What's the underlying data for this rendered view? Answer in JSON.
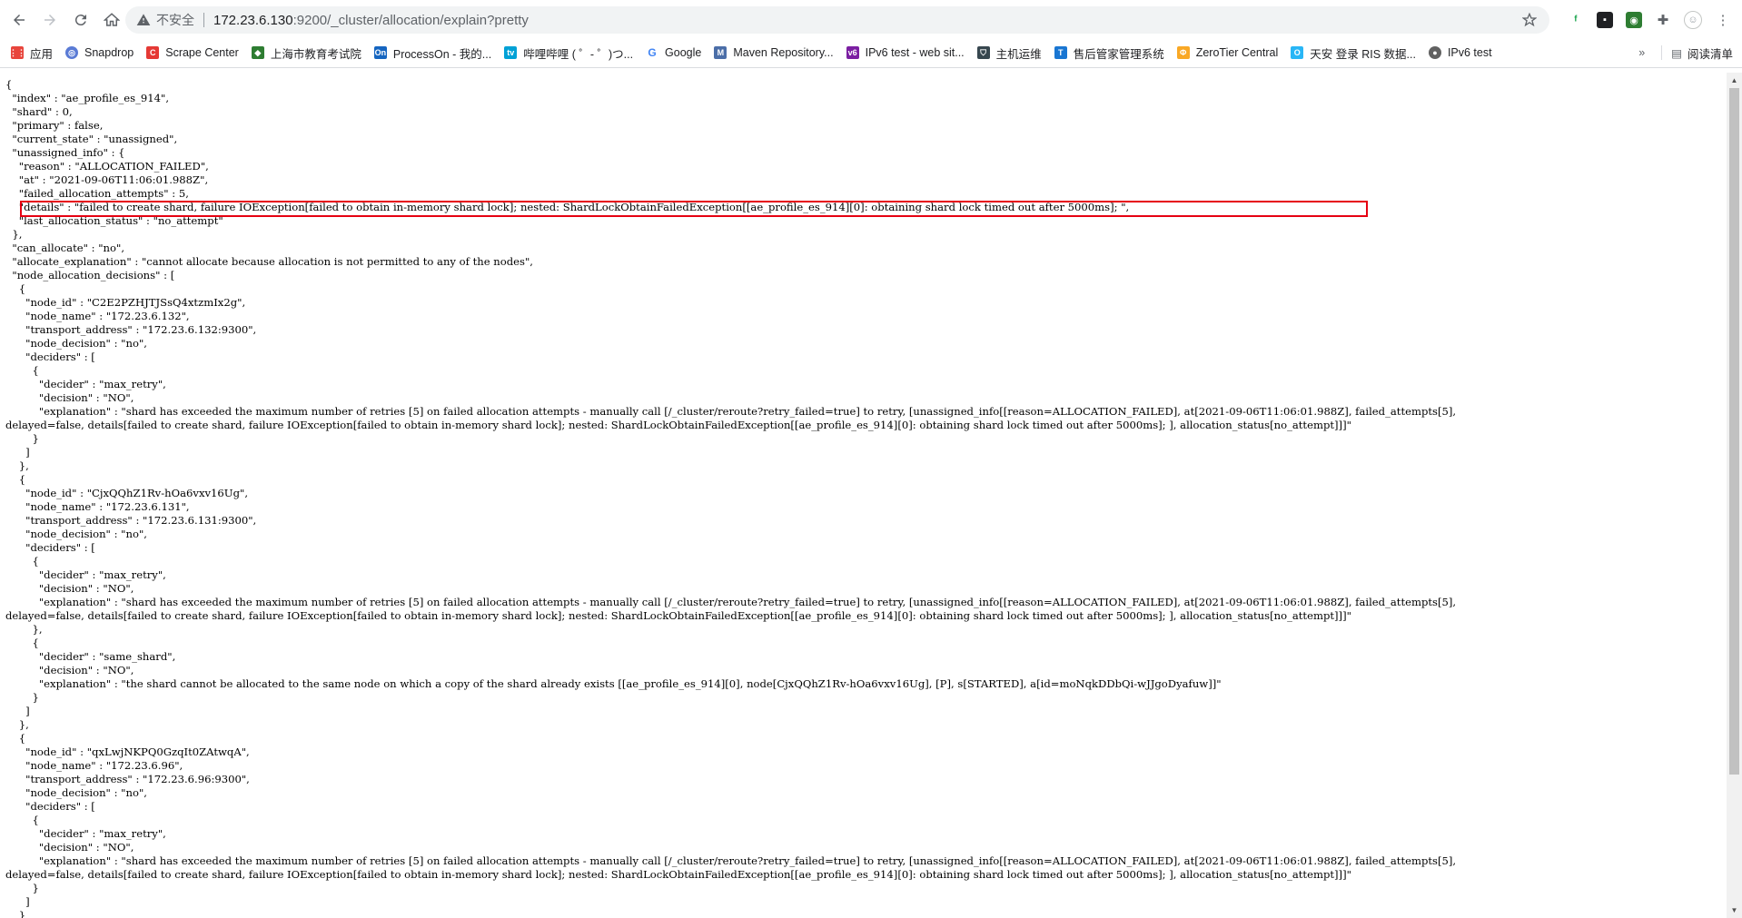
{
  "browser": {
    "insecure_label": "不安全",
    "url_host": "172.23.6.130",
    "url_path": ":9200/_cluster/allocation/explain?pretty",
    "reading_list_label": "阅读清单"
  },
  "bookmarks": [
    {
      "label": "应用",
      "icon": "apps-grid-icon",
      "color": "#e8453c"
    },
    {
      "label": "Snapdrop",
      "icon": "snapdrop-icon",
      "color": "#5a7bd5"
    },
    {
      "label": "Scrape Center",
      "icon": "scrape-center-icon",
      "color": "#e53935"
    },
    {
      "label": "上海市教育考试院",
      "icon": "school-icon",
      "color": "#2e7d32"
    },
    {
      "label": "ProcessOn - 我的...",
      "icon": "processon-icon",
      "color": "#1565c0"
    },
    {
      "label": "哔哩哔哩 ( ゜- ゜)つ...",
      "icon": "bilibili-icon",
      "color": "#00a1d6"
    },
    {
      "label": "Google",
      "icon": "google-icon",
      "color": "#4285f4"
    },
    {
      "label": "Maven Repository...",
      "icon": "maven-icon",
      "color": "#4b6ea8"
    },
    {
      "label": "IPv6 test - web sit...",
      "icon": "ipv6-icon",
      "color": "#7b1fa2"
    },
    {
      "label": "主机运维",
      "icon": "shield-icon",
      "color": "#37474f"
    },
    {
      "label": "售后管家管理系统",
      "icon": "t-icon",
      "color": "#1976d2"
    },
    {
      "label": "ZeroTier Central",
      "icon": "zerotier-icon",
      "color": "#f9a825"
    },
    {
      "label": "天安 登录 RIS 数据...",
      "icon": "tianan-icon",
      "color": "#29b6f6"
    },
    {
      "label": "IPv6 test",
      "icon": "globe-icon",
      "color": "#616161"
    }
  ],
  "json_lines": [
    "{",
    "  \"index\" : \"ae_profile_es_914\",",
    "  \"shard\" : 0,",
    "  \"primary\" : false,",
    "  \"current_state\" : \"unassigned\",",
    "  \"unassigned_info\" : {",
    "    \"reason\" : \"ALLOCATION_FAILED\",",
    "    \"at\" : \"2021-09-06T11:06:01.988Z\",",
    "    \"failed_allocation_attempts\" : 5,",
    "    \"details\" : \"failed to create shard, failure IOException[failed to obtain in-memory shard lock]; nested: ShardLockObtainFailedException[[ae_profile_es_914][0]: obtaining shard lock timed out after 5000ms]; \",",
    "    \"last_allocation_status\" : \"no_attempt\"",
    "  },",
    "  \"can_allocate\" : \"no\",",
    "  \"allocate_explanation\" : \"cannot allocate because allocation is not permitted to any of the nodes\",",
    "  \"node_allocation_decisions\" : [",
    "    {",
    "      \"node_id\" : \"C2E2PZHJTJSsQ4xtzmIx2g\",",
    "      \"node_name\" : \"172.23.6.132\",",
    "      \"transport_address\" : \"172.23.6.132:9300\",",
    "      \"node_decision\" : \"no\",",
    "      \"deciders\" : [",
    "        {",
    "          \"decider\" : \"max_retry\",",
    "          \"decision\" : \"NO\",",
    "          \"explanation\" : \"shard has exceeded the maximum number of retries [5] on failed allocation attempts - manually call [/_cluster/reroute?retry_failed=true] to retry, [unassigned_info[[reason=ALLOCATION_FAILED], at[2021-09-06T11:06:01.988Z], failed_attempts[5],",
    "delayed=false, details[failed to create shard, failure IOException[failed to obtain in-memory shard lock]; nested: ShardLockObtainFailedException[[ae_profile_es_914][0]: obtaining shard lock timed out after 5000ms]; ], allocation_status[no_attempt]]]\"",
    "        }",
    "      ]",
    "    },",
    "    {",
    "      \"node_id\" : \"CjxQQhZ1Rv-hOa6vxv16Ug\",",
    "      \"node_name\" : \"172.23.6.131\",",
    "      \"transport_address\" : \"172.23.6.131:9300\",",
    "      \"node_decision\" : \"no\",",
    "      \"deciders\" : [",
    "        {",
    "          \"decider\" : \"max_retry\",",
    "          \"decision\" : \"NO\",",
    "          \"explanation\" : \"shard has exceeded the maximum number of retries [5] on failed allocation attempts - manually call [/_cluster/reroute?retry_failed=true] to retry, [unassigned_info[[reason=ALLOCATION_FAILED], at[2021-09-06T11:06:01.988Z], failed_attempts[5],",
    "delayed=false, details[failed to create shard, failure IOException[failed to obtain in-memory shard lock]; nested: ShardLockObtainFailedException[[ae_profile_es_914][0]: obtaining shard lock timed out after 5000ms]; ], allocation_status[no_attempt]]]\"",
    "        },",
    "        {",
    "          \"decider\" : \"same_shard\",",
    "          \"decision\" : \"NO\",",
    "          \"explanation\" : \"the shard cannot be allocated to the same node on which a copy of the shard already exists [[ae_profile_es_914][0], node[CjxQQhZ1Rv-hOa6vxv16Ug], [P], s[STARTED], a[id=moNqkDDbQi-wJJgoDyafuw]]\"",
    "        }",
    "      ]",
    "    },",
    "    {",
    "      \"node_id\" : \"qxLwjNKPQ0GzqIt0ZAtwqA\",",
    "      \"node_name\" : \"172.23.6.96\",",
    "      \"transport_address\" : \"172.23.6.96:9300\",",
    "      \"node_decision\" : \"no\",",
    "      \"deciders\" : [",
    "        {",
    "          \"decider\" : \"max_retry\",",
    "          \"decision\" : \"NO\",",
    "          \"explanation\" : \"shard has exceeded the maximum number of retries [5] on failed allocation attempts - manually call [/_cluster/reroute?retry_failed=true] to retry, [unassigned_info[[reason=ALLOCATION_FAILED], at[2021-09-06T11:06:01.988Z], failed_attempts[5],",
    "delayed=false, details[failed to create shard, failure IOException[failed to obtain in-memory shard lock]; nested: ShardLockObtainFailedException[[ae_profile_es_914][0]: obtaining shard lock timed out after 5000ms]; ], allocation_status[no_attempt]]]\"",
    "        }",
    "      ]",
    "    }"
  ]
}
